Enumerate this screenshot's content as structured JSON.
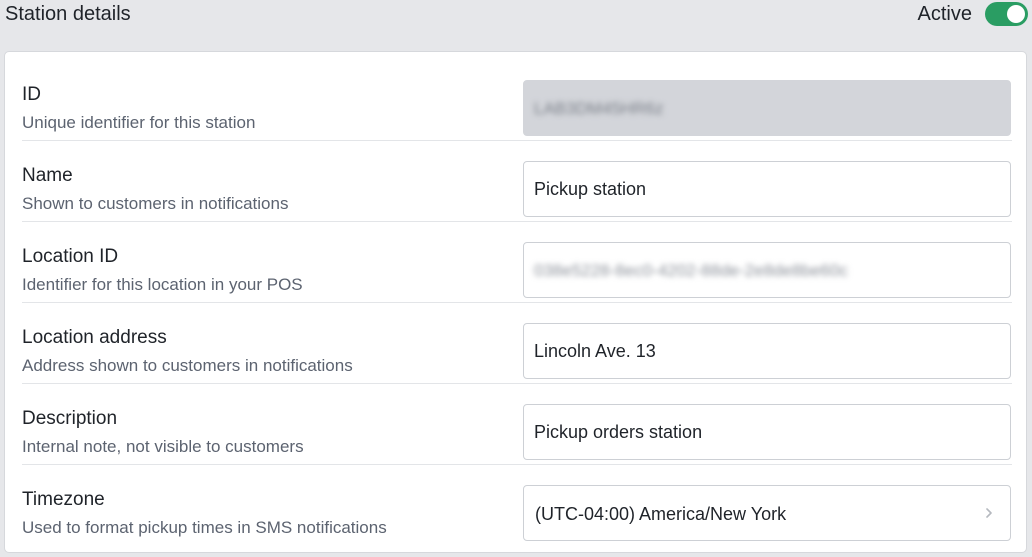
{
  "header": {
    "title": "Station details",
    "active_label": "Active",
    "active_state": true
  },
  "fields": {
    "id": {
      "label": "ID",
      "help": "Unique identifier for this station",
      "value": "LAB3DM45HR6z",
      "redacted": true
    },
    "name": {
      "label": "Name",
      "help": "Shown to customers in notifications",
      "value": "Pickup station"
    },
    "location_id": {
      "label": "Location ID",
      "help": "Identifier for this location in your POS",
      "value": "038e5228-8ec0-4202-88de-2e8de8be60c",
      "redacted": true
    },
    "location_address": {
      "label": "Location address",
      "help": "Address shown to customers in notifications",
      "value": "Lincoln Ave. 13"
    },
    "description": {
      "label": "Description",
      "help": "Internal note, not visible to customers",
      "value": "Pickup orders station"
    },
    "timezone": {
      "label": "Timezone",
      "help": "Used to format pickup times in SMS notifications",
      "value": "(UTC-04:00) America/New York"
    }
  },
  "colors": {
    "accent_green": "#2a9d63",
    "page_bg": "#e6e7ea",
    "readonly_bg": "#d3d5da",
    "text_primary": "#1f2329",
    "text_secondary": "#5c6370"
  },
  "icons": {
    "toggle": "toggle-switch-on",
    "select": "chevron-right-icon"
  }
}
